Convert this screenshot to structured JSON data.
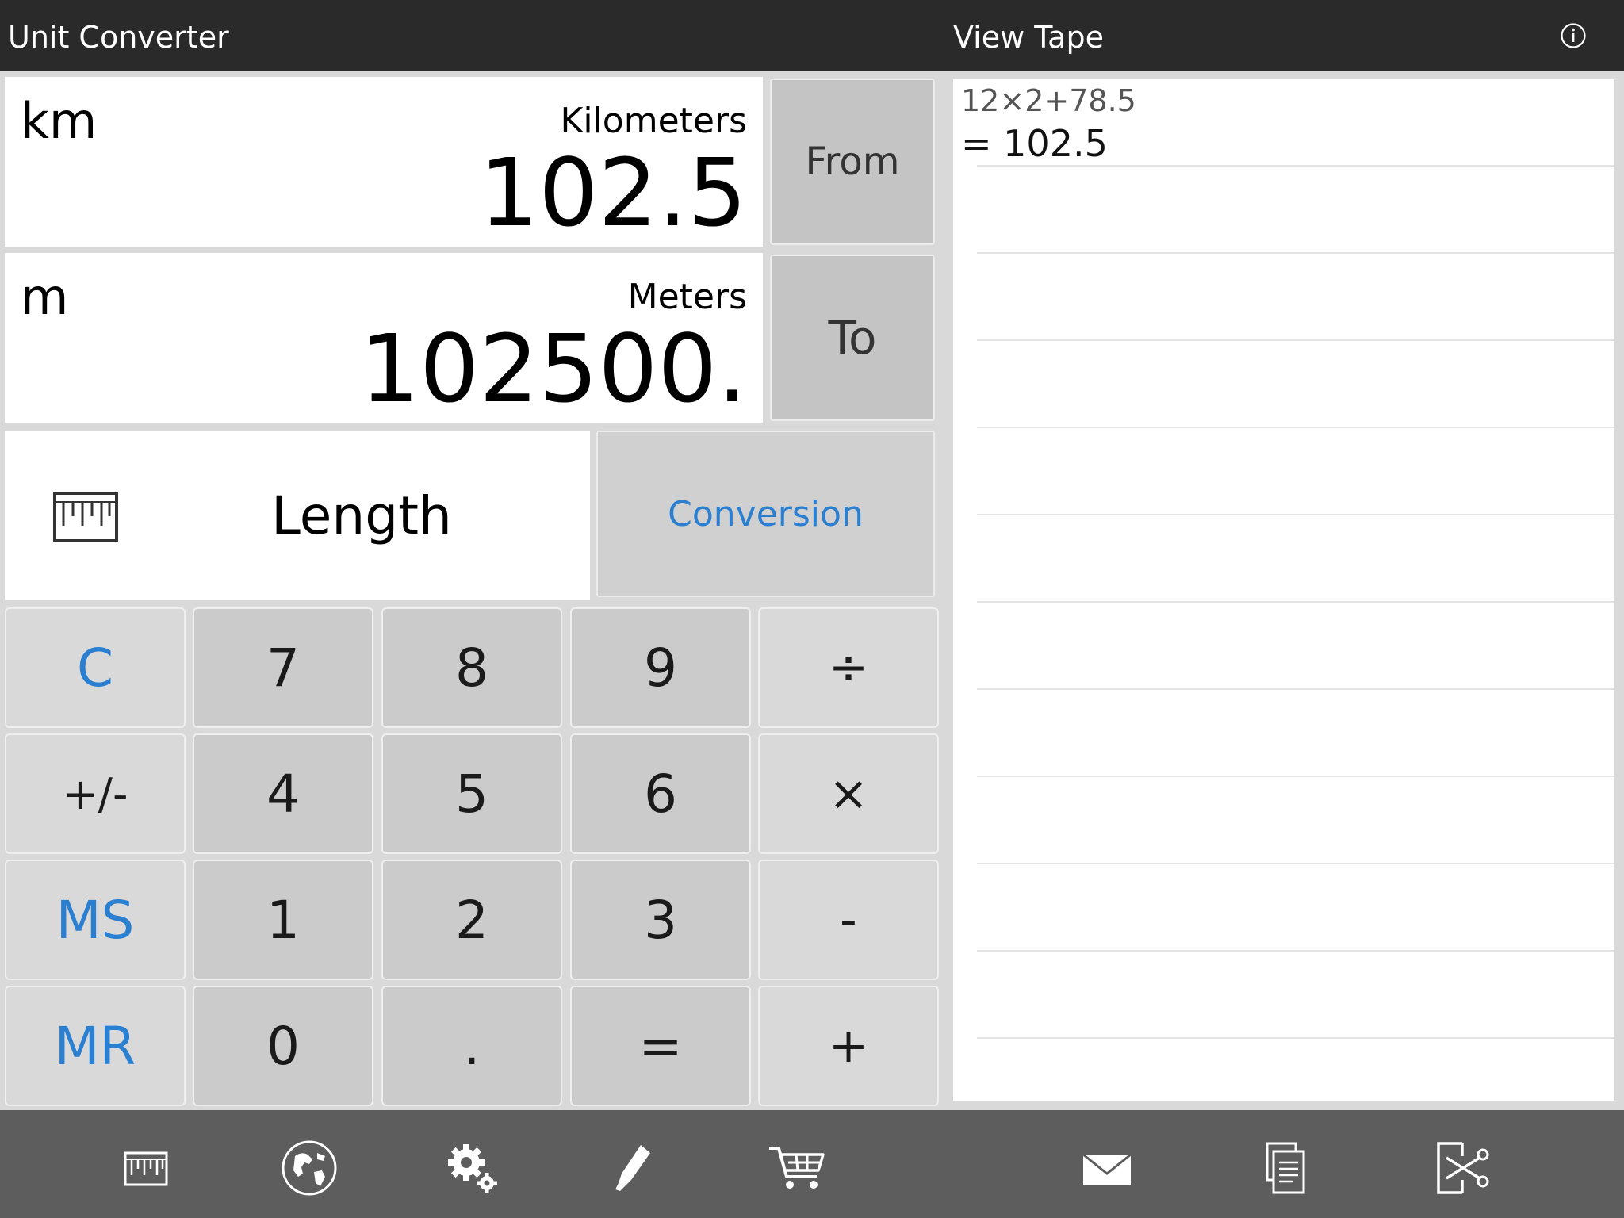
{
  "header": {
    "app_title": "Unit Converter",
    "tape_title": "View Tape",
    "info_icon": "info-icon"
  },
  "from_unit": {
    "abbr": "km",
    "name": "Kilometers",
    "value": "102.5",
    "button_label": "From"
  },
  "to_unit": {
    "abbr": "m",
    "name": "Meters",
    "value": "102500.",
    "button_label": "To"
  },
  "category": {
    "icon": "ruler-icon",
    "label": "Length",
    "mode_button_label": "Conversion"
  },
  "keypad": {
    "clear": "C",
    "seven": "7",
    "eight": "8",
    "nine": "9",
    "divide": "÷",
    "sign": "+/-",
    "four": "4",
    "five": "5",
    "six": "6",
    "multiply": "×",
    "memory_store": "MS",
    "one": "1",
    "two": "2",
    "three": "3",
    "minus": "-",
    "memory_recall": "MR",
    "zero": "0",
    "decimal": ".",
    "equals": "=",
    "plus": "+"
  },
  "tape": {
    "expression": "12×2+78.5",
    "result": "= 102.5"
  },
  "toolbar": {
    "items": [
      "ruler-icon",
      "globe-icon",
      "settings-gears-icon",
      "pen-icon",
      "shopping-cart-icon",
      "mail-icon",
      "copy-icon",
      "cut-icon"
    ]
  },
  "colors": {
    "topbar_bg": "#2a2a2a",
    "accent_blue": "#2b7fd0",
    "toolbar_bg": "#5d5d5d",
    "key_light": "#d9d9d9",
    "key_dark": "#cbcbcb"
  }
}
